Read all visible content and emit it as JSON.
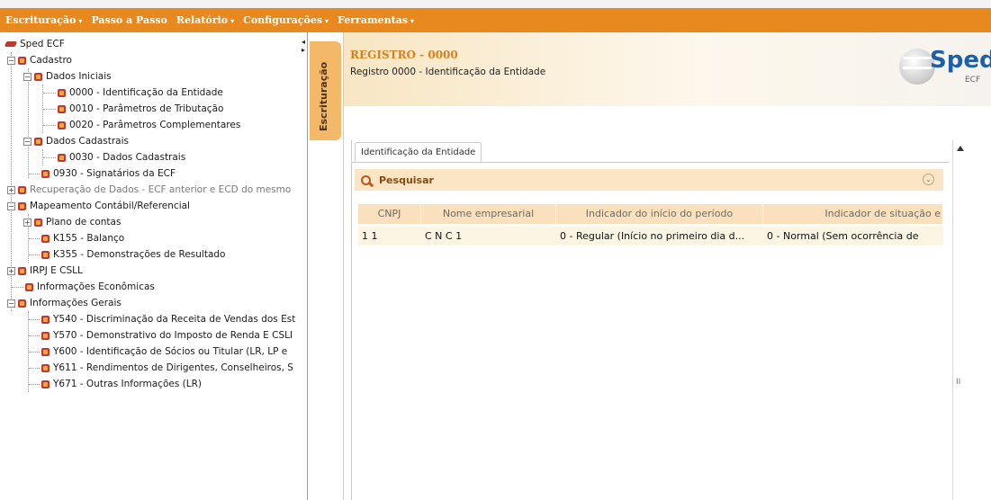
{
  "menu": [
    {
      "label": "Escrituração",
      "caret": "▾"
    },
    {
      "label": "Passo a Passo",
      "caret": ""
    },
    {
      "label": "Relatório",
      "caret": "▾"
    },
    {
      "label": "Configurações",
      "caret": "▾"
    },
    {
      "label": "Ferramentas",
      "caret": "▾"
    }
  ],
  "tree": {
    "root": "Sped ECF",
    "cadastro": "Cadastro",
    "dados_iniciais": "Dados Iniciais",
    "r0000": "0000 - Identificação da Entidade",
    "r0010": "0010 - Parâmetros de Tributação",
    "r0020": "0020 - Parâmetros Complementares",
    "dados_cadastrais": "Dados Cadastrais",
    "r0030": "0030 - Dados Cadastrais",
    "r0930": "0930 - Signatários da ECF",
    "recuperacao": "Recuperação de Dados - ECF anterior e ECD do mesmo",
    "mapeamento": "Mapeamento Contábil/Referencial",
    "plano": "Plano de contas",
    "k155": "K155 - Balanço",
    "k355": "K355 - Demonstrações de Resultado",
    "irpj": "IRPJ E CSLL",
    "info_econ": "Informações Econômicas",
    "info_gerais": "Informações Gerais",
    "y540": "Y540 - Discriminação da Receita de Vendas dos Est",
    "y570": "Y570 - Demonstrativo do Imposto de Renda E CSLI",
    "y600": "Y600 - Identificação de Sócios ou Titular (LR, LP e",
    "y611": "Y611 - Rendimentos de Dirigentes, Conselheiros, S",
    "y671": "Y671 - Outras Informações (LR)"
  },
  "side_tab": "Escrituração",
  "header": {
    "code": "REGISTRO - 0000",
    "desc": "Registro 0000 - Identificação da Entidade",
    "logo_word": "Sped",
    "logo_sub": "ECF"
  },
  "entity_tab": "Identificação da Entidade",
  "search": {
    "label": "Pesquisar",
    "toggle": "⌄"
  },
  "table": {
    "columns": [
      "CNPJ",
      "Nome empresarial",
      "Indicador do início do período",
      "Indicador de situação e"
    ],
    "rows": [
      [
        "1   1",
        "C      N   C    1",
        "0 - Regular (Início no primeiro dia d...",
        "0 - Normal (Sem ocorrência de"
      ]
    ]
  },
  "icons": {
    "search": "search-icon",
    "collapse_toggle": "chevron-down-circle-icon",
    "scroll_up": "arrow-up-icon"
  },
  "colors": {
    "menubar": "#e8891f",
    "accent_text": "#d4811c",
    "brand_blue": "#1f5fa8",
    "header_row": "#fae0bd",
    "data_row": "#fdf5e3"
  }
}
